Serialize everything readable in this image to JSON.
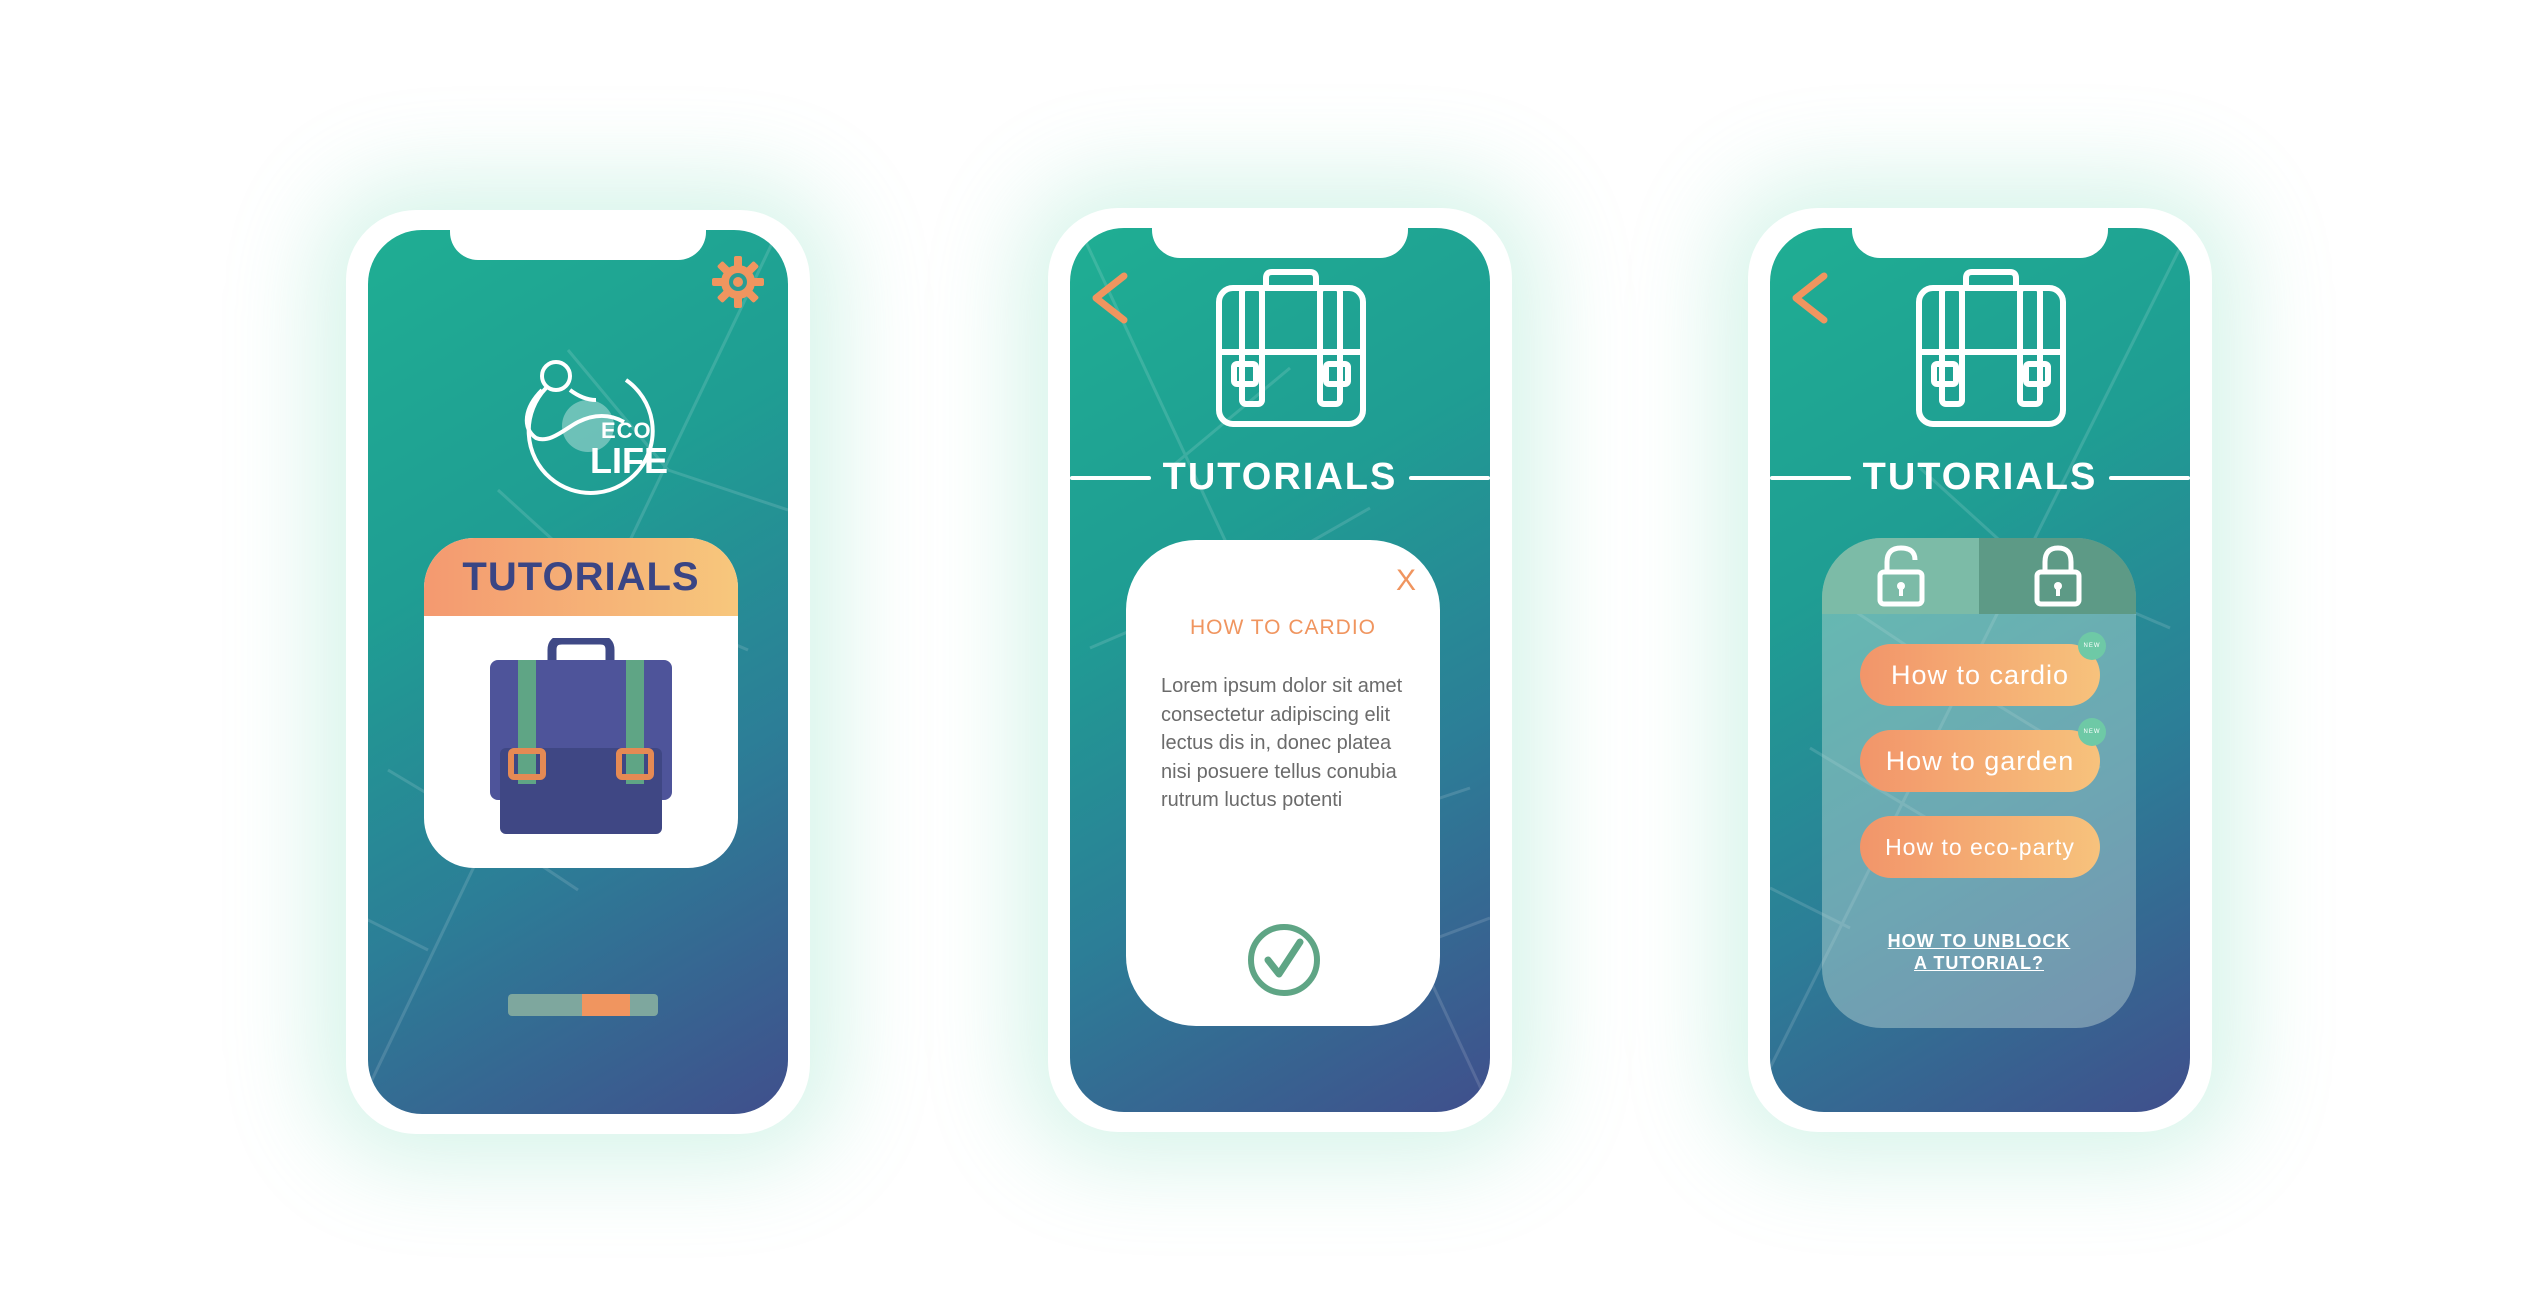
{
  "colors": {
    "accent_orange": "#f0955f",
    "title_navy": "#3a4584",
    "teal_green": "#6ec9a6",
    "gradient_start": "#1fae93",
    "gradient_end": "#404f8c"
  },
  "screen1": {
    "logo": {
      "line1": "ECO",
      "line2": "LIFE"
    },
    "card_title": "TUTORIALS",
    "icons": {
      "settings": "gear-icon",
      "card": "backpack-icon"
    },
    "pager": {
      "pages": 3,
      "active_page": 2
    }
  },
  "screen2": {
    "heading": "TUTORIALS",
    "icons": {
      "back": "chevron-left-icon",
      "header": "backpack-outline-icon",
      "confirm": "checkmark-circle-icon"
    },
    "modal": {
      "close_label": "X",
      "title": "HOW TO CARDIO",
      "body": "Lorem ipsum dolor sit amet consectetur adipiscing elit lectus dis in, donec platea nisi posuere tellus conubia rutrum luctus potenti"
    }
  },
  "screen3": {
    "heading": "TUTORIALS",
    "icons": {
      "back": "chevron-left-icon",
      "header": "backpack-outline-icon"
    },
    "tabs": [
      {
        "name": "unlocked",
        "icon": "unlocked-padlock-icon"
      },
      {
        "name": "locked",
        "icon": "locked-padlock-icon"
      }
    ],
    "items": [
      {
        "label": "How to cardio",
        "badge": "NEW"
      },
      {
        "label": "How to garden",
        "badge": "NEW"
      },
      {
        "label": "How to eco-party"
      }
    ],
    "unblock_line1": "HOW TO UNBLOCK",
    "unblock_line2": "A TUTORIAL?"
  }
}
